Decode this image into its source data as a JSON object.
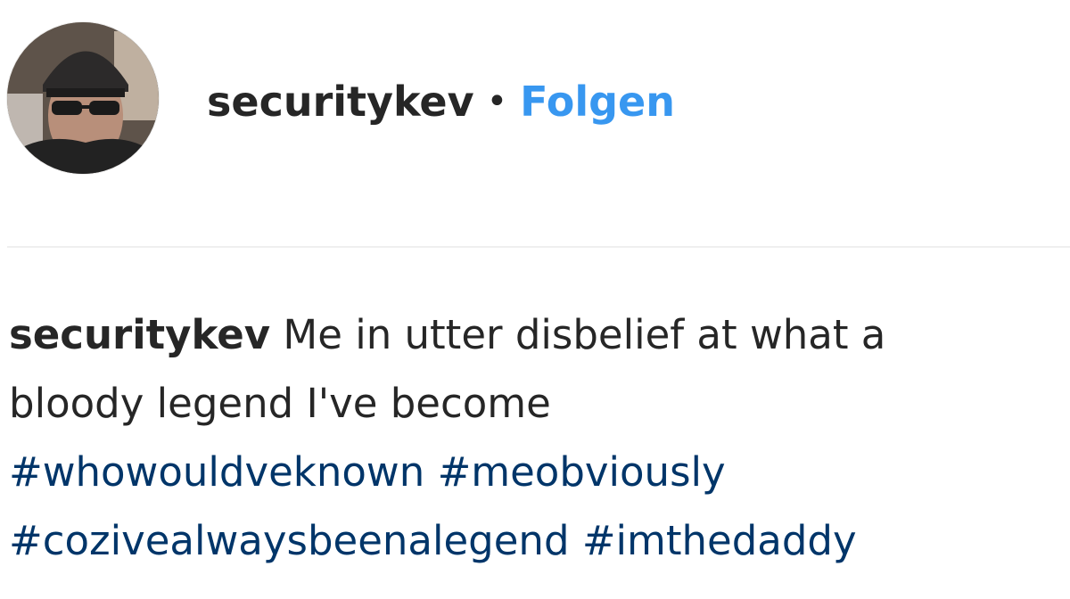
{
  "post": {
    "username": "securitykev",
    "separator": "•",
    "follow_label": "Folgen",
    "avatar_icon": "profile-photo-icon",
    "caption": {
      "username": "securitykev",
      "line1": "Me in utter disbelief at what a",
      "line2": "bloody legend I've become",
      "hashtags": [
        "#whowouldveknown",
        "#meobviously",
        "#cozivealwaysbeenalegend",
        "#imthedaddy"
      ]
    }
  },
  "colors": {
    "link": "#3897f0",
    "hashtag": "#003569",
    "text": "#262626",
    "divider": "#efefef"
  }
}
